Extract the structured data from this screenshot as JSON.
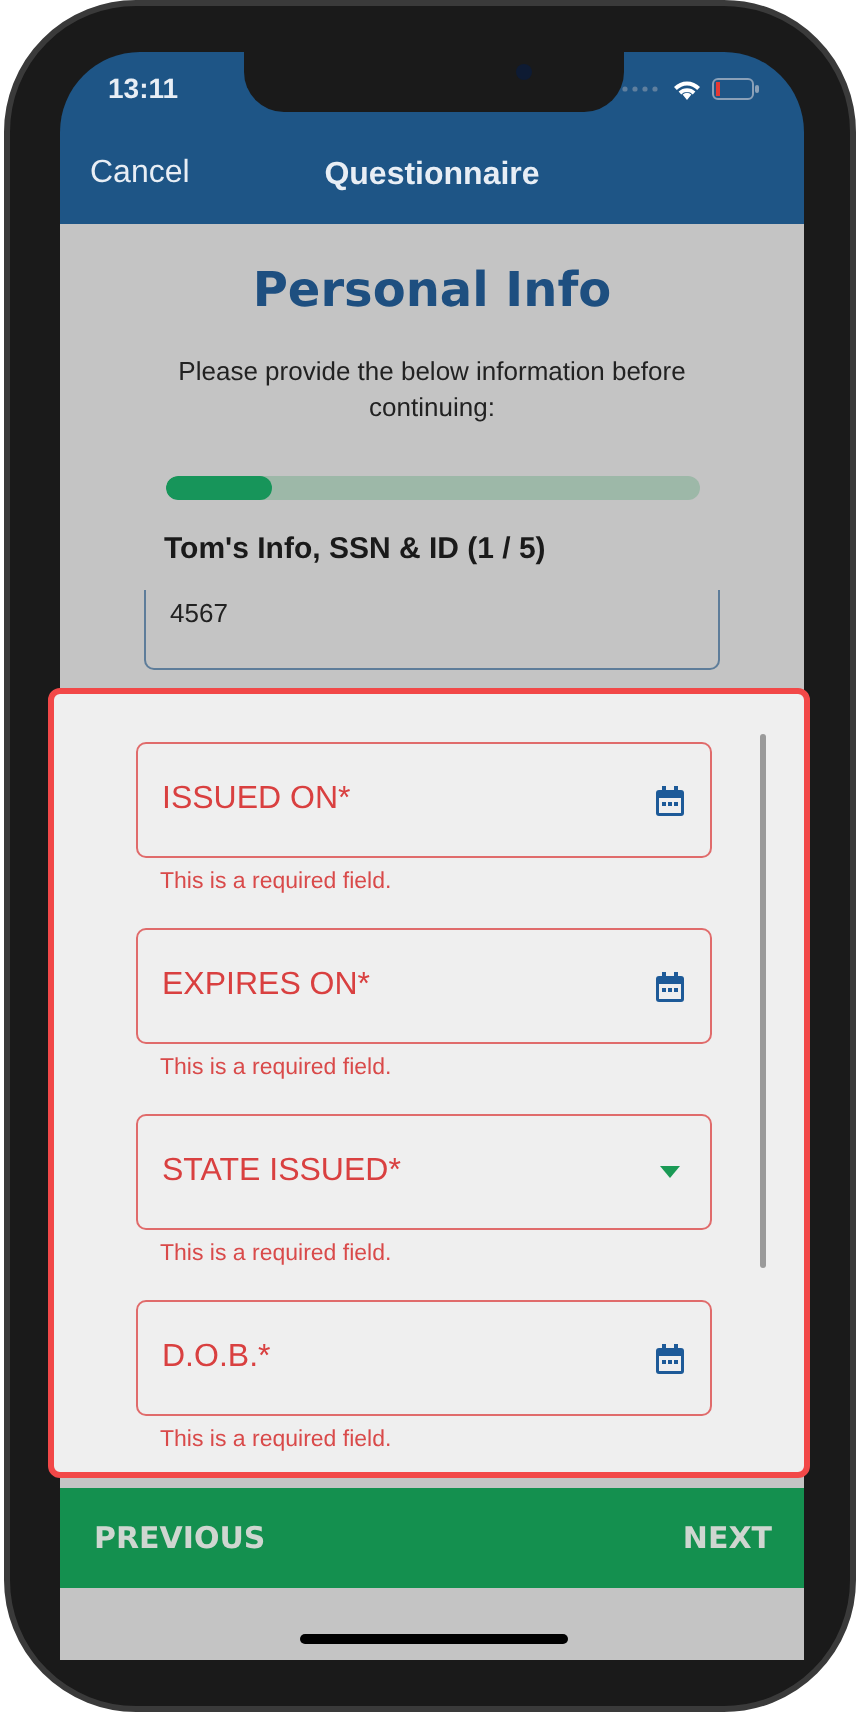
{
  "status_bar": {
    "time": "13:11"
  },
  "nav": {
    "cancel": "Cancel",
    "title": "Questionnaire"
  },
  "heading": "Personal Info",
  "instructions": "Please provide the below information before continuing:",
  "progress": {
    "level": 0.2
  },
  "section_title": "Tom's Info, SSN & ID (1 / 5)",
  "partial_field": {
    "value": "4567"
  },
  "fields": [
    {
      "kind": "date",
      "label": "ISSUED ON*",
      "error": "This is a required field."
    },
    {
      "kind": "date",
      "label": "EXPIRES ON*",
      "error": "This is a required field."
    },
    {
      "kind": "select",
      "label": "STATE ISSUED*",
      "error": "This is a required field."
    },
    {
      "kind": "date",
      "label": "D.O.B.*",
      "error": "This is a required field."
    }
  ],
  "footer": {
    "previous": "PREVIOUS",
    "next": "NEXT"
  }
}
